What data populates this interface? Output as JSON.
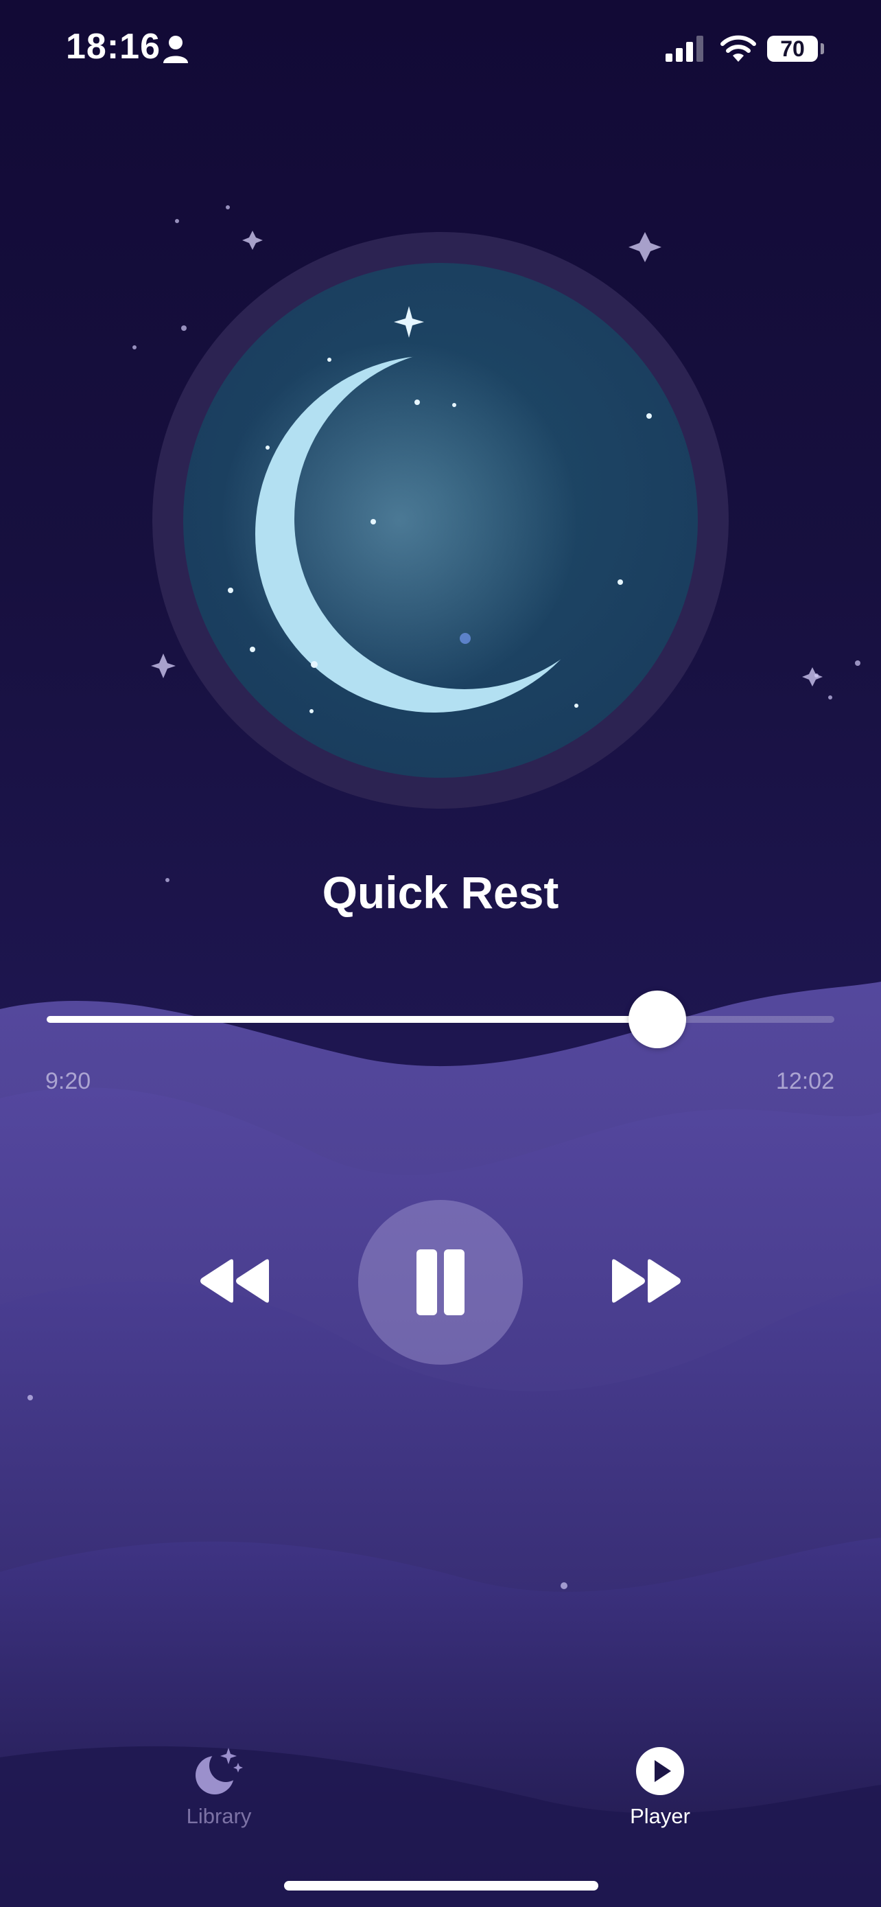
{
  "status_bar": {
    "time": "18:16",
    "battery": "70"
  },
  "now_playing": {
    "title": "Quick Rest",
    "elapsed": "9:20",
    "total": "12:02",
    "progress_fraction": 0.775
  },
  "controls": {
    "rewind_icon": "rewind-icon",
    "play_pause_icon": "pause-icon",
    "forward_icon": "fast-forward-icon"
  },
  "tab_bar": {
    "tabs": [
      {
        "label": "Library",
        "icon": "moon-stars-icon",
        "active": false
      },
      {
        "label": "Player",
        "icon": "play-circle-icon",
        "active": true
      }
    ]
  },
  "colors": {
    "background": "#17103d",
    "accent": "#ffffff",
    "artwork_ring": "#2c2352",
    "artwork_fill": "#1e4a66",
    "moon": "#a9d8ec",
    "hills": "#4a3d8f"
  }
}
